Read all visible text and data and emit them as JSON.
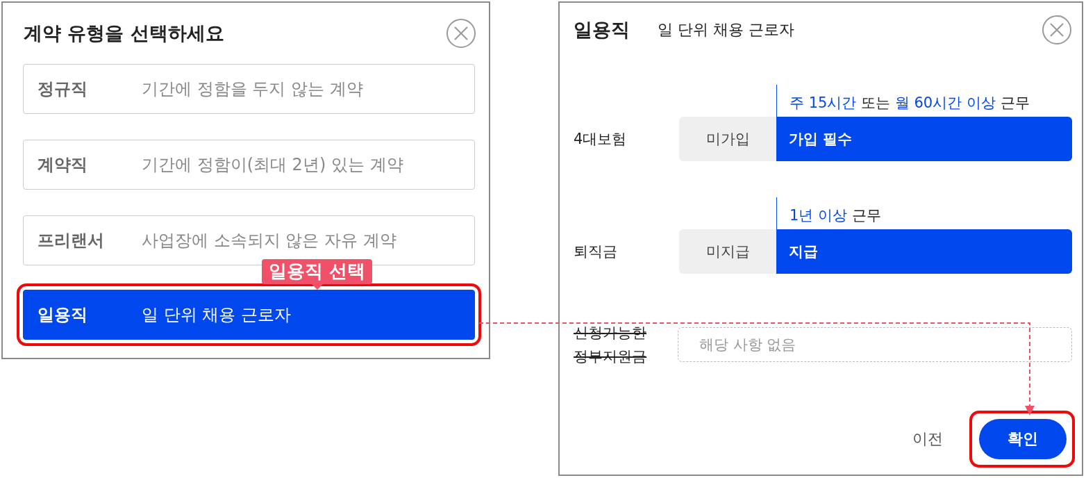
{
  "left_dialog": {
    "title": "계약 유형을 선택하세요",
    "options": [
      {
        "name": "정규직",
        "description": "기간에 정함을 두지 않는 계약",
        "selected": false,
        "highlighted": false
      },
      {
        "name": "계약직",
        "description": "기간에 정함이(최대 2년) 있는 계약",
        "selected": false,
        "highlighted": false
      },
      {
        "name": "프리랜서",
        "description": "사업장에 소속되지 않은 자유 계약",
        "selected": false,
        "highlighted": false
      },
      {
        "name": "일용직",
        "description": "일 단위 채용 근로자",
        "selected": true,
        "highlighted": true
      }
    ]
  },
  "callout": {
    "label": "일용직 선택"
  },
  "right_dialog": {
    "title": "일용직",
    "subtitle": "일 단위 채용 근로자",
    "rows": [
      {
        "kind": "toggle",
        "label": "4대보험",
        "condition": [
          {
            "text": "주 15시간",
            "highlight": true
          },
          {
            "text": "또는",
            "highlight": false
          },
          {
            "text": "월 60시간 이상",
            "highlight": true
          },
          {
            "text": "근무",
            "highlight": false
          }
        ],
        "options": [
          {
            "label": "미가입",
            "selected": false
          },
          {
            "label": "가입 필수",
            "selected": true
          }
        ]
      },
      {
        "kind": "toggle",
        "label": "퇴직금",
        "condition": [
          {
            "text": "1년 이상",
            "highlight": true
          },
          {
            "text": "근무",
            "highlight": false
          }
        ],
        "options": [
          {
            "label": "미지급",
            "selected": false
          },
          {
            "label": "지급",
            "selected": true
          }
        ]
      },
      {
        "kind": "field",
        "label": "신청가능한 정부지원금",
        "struck": true,
        "placeholder": "해당 사항 없음"
      }
    ],
    "buttons": [
      {
        "label": "이전",
        "kind": "text",
        "highlighted": false
      },
      {
        "label": "확인",
        "kind": "primary",
        "highlighted": true
      }
    ]
  }
}
